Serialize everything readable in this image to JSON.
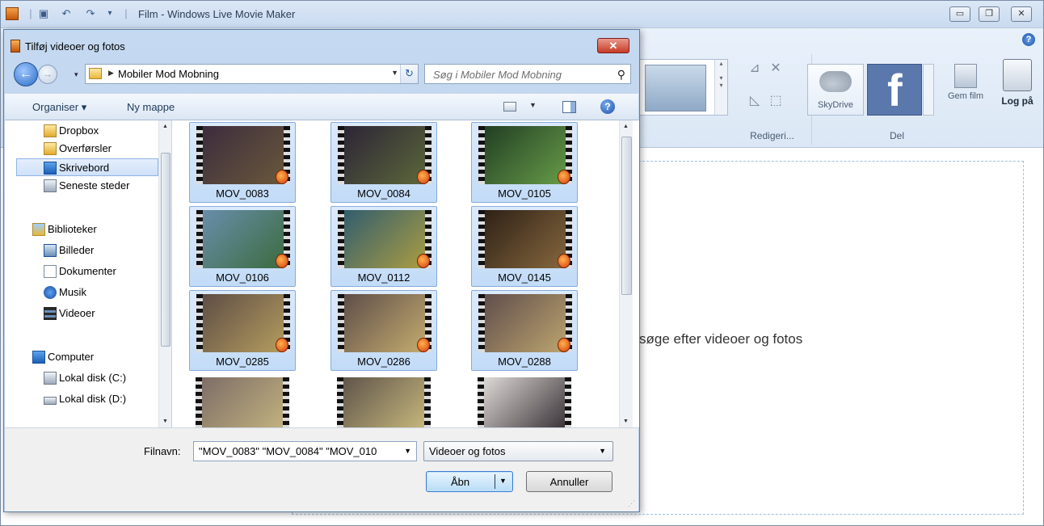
{
  "window": {
    "title": "Film - Windows Live Movie Maker",
    "quick_access": [
      "save-icon",
      "undo-icon",
      "redo-icon",
      "customize-icon"
    ]
  },
  "ribbon": {
    "groups": [
      {
        "label": "Redigeri..."
      },
      {
        "label": "Del"
      }
    ],
    "skydrive_label": "SkyDrive",
    "facebook_label": "f",
    "gem_film_label": "Gem film",
    "log_pa_label": "Log på"
  },
  "main": {
    "hint": "søge efter videoer og fotos"
  },
  "dialog": {
    "title": "Tilføj videoer og fotos",
    "address": {
      "path": "Mobiler Mod Mobning"
    },
    "search_placeholder": "Søg i Mobiler Mod Mobning",
    "commands": {
      "organize": "Organiser ▾",
      "new_folder": "Ny mappe"
    },
    "nav": {
      "items": [
        {
          "label": "Dropbox",
          "icon": "folder-icon"
        },
        {
          "label": "Overførsler",
          "icon": "folder-icon"
        },
        {
          "label": "Skrivebord",
          "icon": "desktop-icon",
          "selected": true
        },
        {
          "label": "Seneste steder",
          "icon": "recent-icon"
        },
        {
          "label": "Biblioteker",
          "icon": "libraries-icon"
        },
        {
          "label": "Billeder",
          "icon": "pictures-icon"
        },
        {
          "label": "Dokumenter",
          "icon": "documents-icon"
        },
        {
          "label": "Musik",
          "icon": "music-icon"
        },
        {
          "label": "Videoer",
          "icon": "videos-icon"
        },
        {
          "label": "Computer",
          "icon": "computer-icon"
        },
        {
          "label": "Lokal disk (C:)",
          "icon": "drive-icon"
        },
        {
          "label": "Lokal disk (D:)",
          "icon": "drive-icon"
        }
      ]
    },
    "files": [
      {
        "name": "MOV_0083"
      },
      {
        "name": "MOV_0084"
      },
      {
        "name": "MOV_0105"
      },
      {
        "name": "MOV_0106"
      },
      {
        "name": "MOV_0112"
      },
      {
        "name": "MOV_0145"
      },
      {
        "name": "MOV_0285"
      },
      {
        "name": "MOV_0286"
      },
      {
        "name": "MOV_0288"
      },
      {
        "name": ""
      },
      {
        "name": ""
      },
      {
        "name": ""
      }
    ],
    "filename_label": "Filnavn:",
    "filename_value": "\"MOV_0083\" \"MOV_0084\" \"MOV_010",
    "filetype_value": "Videoer og fotos",
    "open_label": "Åbn",
    "cancel_label": "Annuller"
  },
  "colors": {
    "accent": "#3a7bd2",
    "selection": "#c2dbf7",
    "facebook": "#5a78ac"
  }
}
